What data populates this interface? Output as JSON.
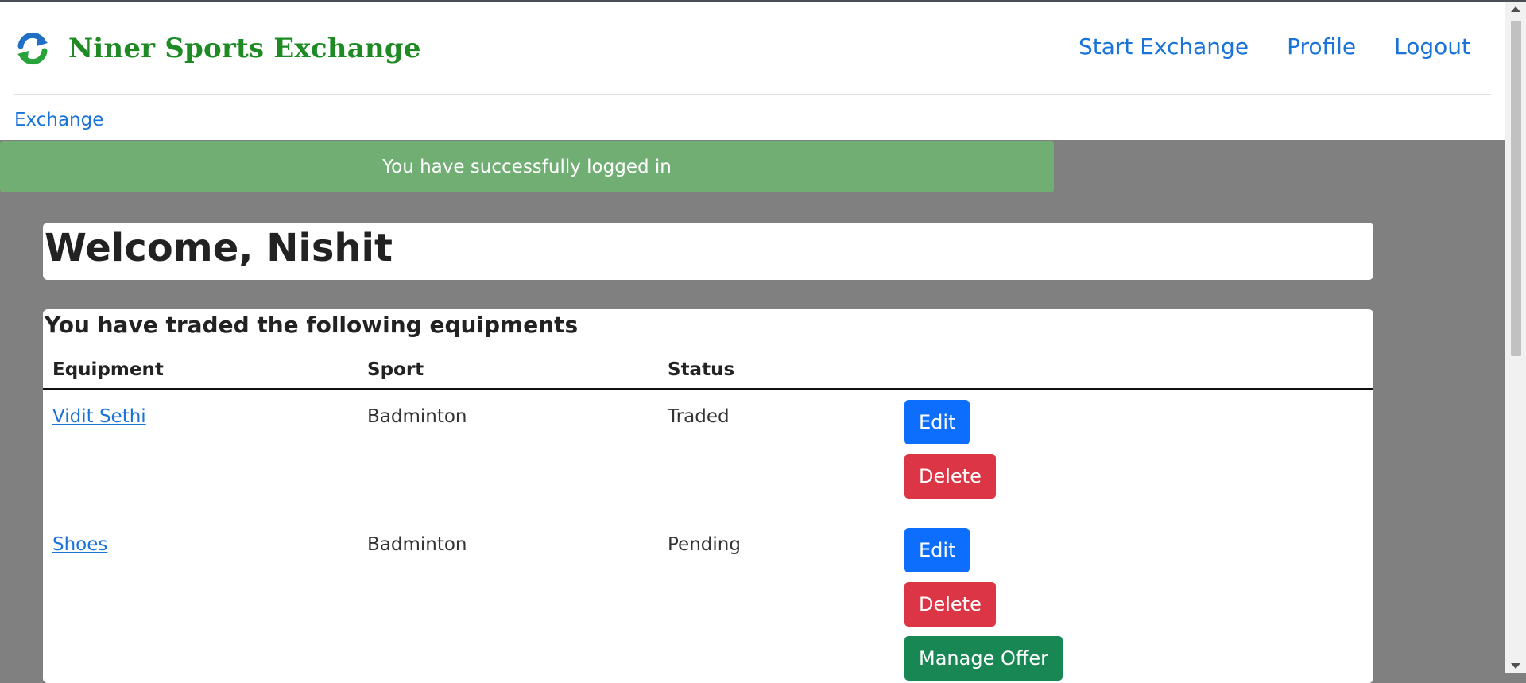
{
  "brand": {
    "title": "Niner Sports Exchange",
    "logo_icon": "exchange-arrows-icon"
  },
  "nav": {
    "start_exchange": "Start Exchange",
    "profile": "Profile",
    "logout": "Logout"
  },
  "subnav": {
    "exchange": "Exchange"
  },
  "alert": {
    "message": "You have successfully logged in"
  },
  "welcome": {
    "heading": "Welcome, Nishit"
  },
  "traded": {
    "heading": "You have traded the following equipments",
    "columns": [
      "Equipment",
      "Sport",
      "Status"
    ],
    "rows": [
      {
        "equipment": "Vidit Sethi",
        "sport": "Badminton",
        "status": "Traded",
        "edit": "Edit",
        "delete": "Delete"
      },
      {
        "equipment": "Shoes",
        "sport": "Badminton",
        "status": "Pending",
        "edit": "Edit",
        "delete": "Delete",
        "manage": "Manage Offer"
      }
    ]
  },
  "colors": {
    "brand_green": "#1d8a24",
    "link_blue": "#1a73d9",
    "alert_green": "#70ae74",
    "btn_primary": "#0d6efd",
    "btn_danger": "#dc3545",
    "btn_success": "#198754",
    "page_bg": "#808080"
  }
}
